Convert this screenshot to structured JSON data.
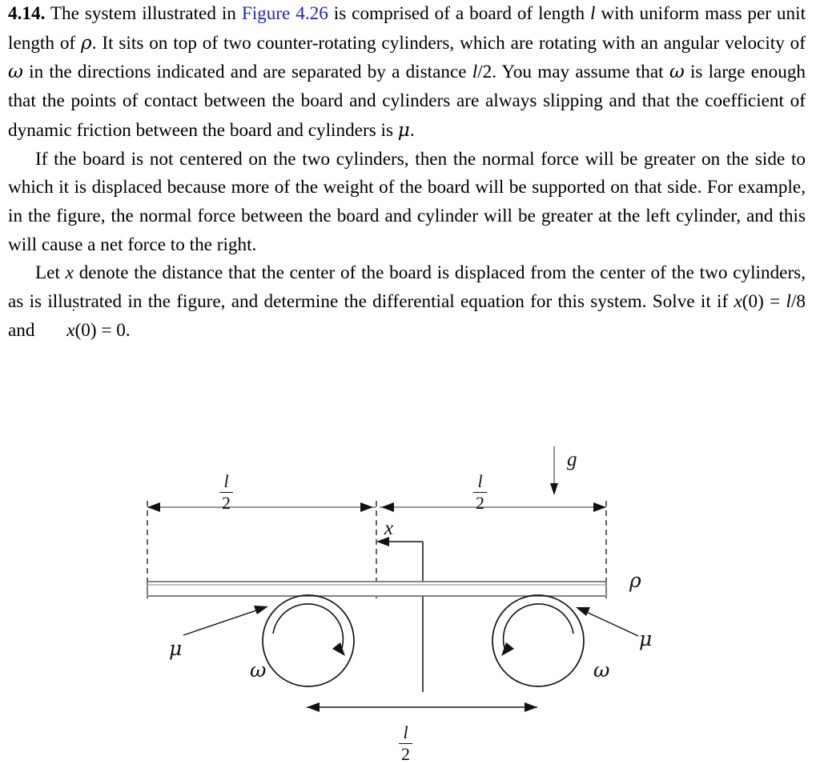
{
  "problem": {
    "number": "4.14.",
    "paragraph1_before_link": "The system illustrated in ",
    "figure_link": "Figure 4.26",
    "paragraph1_after_link": " is comprised of a board of length l with uniform mass per unit length of ρ. It sits on top of two counter-rotating cylinders, which are rotating with an angular velocity of ω in the directions indicated and are separated by a distance l/2. You may assume that ω is large enough that the points of contact between the board and cylinders are always slipping and that the coefficient of dynamic friction between the board and cylinders is μ.",
    "paragraph2": "If the board is not centered on the two cylinders, then the normal force will be greater on the side to which it is displaced because more of the weight of the board will be supported on that side. For example, in the figure, the normal force between the board and cylinder will be greater at the left cylinder, and this will cause a net force to the right.",
    "paragraph3_a": "Let x denote the distance that the center of the board is displaced from the center of the two cylinders, as is illustrated in the figure, and determine the differential equation for this system. Solve it if x(0) = l/8 and ",
    "paragraph3_b": "(0) = 0.",
    "link_color": "#2222cc"
  },
  "figure": {
    "labels": {
      "gravity": "g",
      "density": "ρ",
      "displacement": "x",
      "friction_left": "μ",
      "friction_right": "μ",
      "omega_left": "ω",
      "omega_right": "ω"
    },
    "dimensions": {
      "half_length_top_left_num": "l",
      "half_length_top_left_den": "2",
      "half_length_top_right_num": "l",
      "half_length_top_right_den": "2",
      "half_length_bottom_num": "l",
      "half_length_bottom_den": "2"
    },
    "stroke_color": "#1a1a1a",
    "board_stroke": "#555555"
  }
}
